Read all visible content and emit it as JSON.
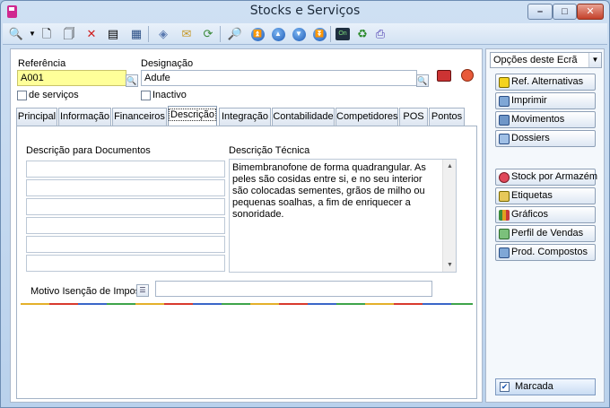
{
  "window": {
    "title": "Stocks e Serviços"
  },
  "toolbar": {
    "icons": [
      "search-icon",
      "new-document-icon",
      "copy-document-icon",
      "delete-icon",
      "properties-icon",
      "table-icon",
      "print-box-icon",
      "mail-icon",
      "refresh-icon",
      "preview-icon",
      "first-record-icon",
      "previous-record-icon",
      "next-record-icon",
      "last-record-icon",
      "on-icon",
      "sync-icon",
      "export-icon"
    ]
  },
  "header": {
    "referencia_label": "Referência",
    "referencia_value": "A001",
    "designacao_label": "Designação",
    "designacao_value": "Adufe",
    "servicos_label": "de serviços",
    "inactivo_label": "Inactivo"
  },
  "tabs": [
    {
      "label": "Principal"
    },
    {
      "label": "Informação"
    },
    {
      "label": "Financeiros"
    },
    {
      "label": "Descrição",
      "active": true
    },
    {
      "label": "Integração"
    },
    {
      "label": "Contabilidade"
    },
    {
      "label": "Competidores"
    },
    {
      "label": "POS"
    },
    {
      "label": "Pontos"
    }
  ],
  "descricao": {
    "doc_label": "Descrição para Documentos",
    "tec_label": "Descrição Técnica",
    "tec_text": "Bimembranofone de forma quadrangular. As peles são cosidas entre si, e no seu interior são colocadas sementes, grãos de milho ou pequenas soalhas, a fim de enriquecer a sonoridade.",
    "motivo_label": "Motivo Isenção de Imposto"
  },
  "side": {
    "dropdown_value": "Opções deste Ecrã",
    "buttons": [
      {
        "label": "Ref. Alternativas"
      },
      {
        "label": "Imprimir"
      },
      {
        "label": "Movimentos"
      },
      {
        "label": "Dossiers"
      },
      {
        "label": "Stock por Armazém"
      },
      {
        "label": "Etiquetas"
      },
      {
        "label": "Gráficos"
      },
      {
        "label": "Perfil de Vendas"
      },
      {
        "label": "Prod. Compostos"
      }
    ],
    "marcada_label": "Marcada"
  }
}
